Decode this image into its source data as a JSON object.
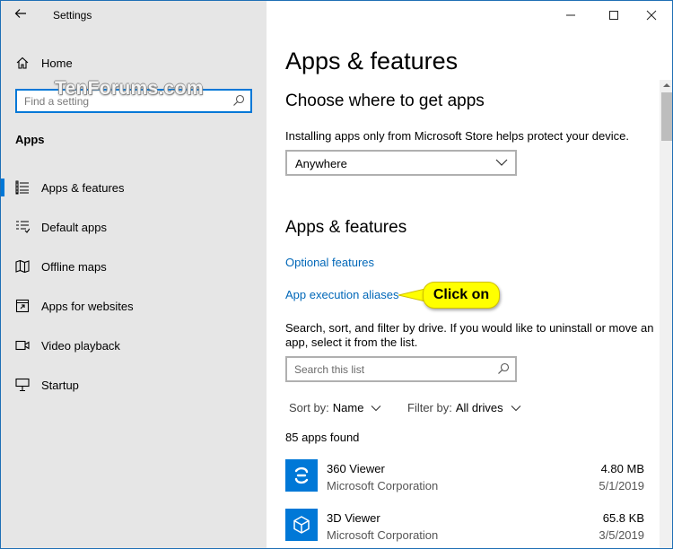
{
  "window": {
    "title": "Settings",
    "controls": {
      "minimize_icon": "minimize-icon",
      "maximize_icon": "maximize-icon",
      "close_icon": "close-icon"
    }
  },
  "watermark": "TenForums.com",
  "sidebar": {
    "home_label": "Home",
    "search": {
      "placeholder": "Find a setting"
    },
    "section_label": "Apps",
    "items": [
      {
        "label": "Apps & features",
        "icon": "list-icon",
        "active": true
      },
      {
        "label": "Default apps",
        "icon": "default-apps-icon",
        "active": false
      },
      {
        "label": "Offline maps",
        "icon": "map-icon",
        "active": false
      },
      {
        "label": "Apps for websites",
        "icon": "link-window-icon",
        "active": false
      },
      {
        "label": "Video playback",
        "icon": "video-icon",
        "active": false
      },
      {
        "label": "Startup",
        "icon": "startup-icon",
        "active": false
      }
    ]
  },
  "main": {
    "page_title": "Apps & features",
    "choose_heading": "Choose where to get apps",
    "choose_desc": "Installing apps only from Microsoft Store helps protect your device.",
    "source_dropdown": {
      "value": "Anywhere"
    },
    "apps_heading": "Apps & features",
    "optional_features_link": "Optional features",
    "aliases_link": "App execution aliases",
    "callout": "Click on",
    "filter_desc": "Search, sort, and filter by drive. If you would like to uninstall or move an app, select it from the list.",
    "list_search": {
      "placeholder": "Search this list"
    },
    "sort_by": {
      "label": "Sort by:",
      "value": "Name"
    },
    "filter_by": {
      "label": "Filter by:",
      "value": "All drives"
    },
    "count": "85 apps found",
    "apps": [
      {
        "name": "360 Viewer",
        "publisher": "Microsoft Corporation",
        "size": "4.80 MB",
        "date": "5/1/2019",
        "icon": "360-viewer-icon"
      },
      {
        "name": "3D Viewer",
        "publisher": "Microsoft Corporation",
        "size": "65.8 KB",
        "date": "3/5/2019",
        "icon": "3d-cube-icon"
      }
    ]
  },
  "colors": {
    "accent": "#0078d7",
    "link": "#0067b8",
    "sidebar_bg": "#e6e6e6",
    "callout": "#ffff00"
  }
}
